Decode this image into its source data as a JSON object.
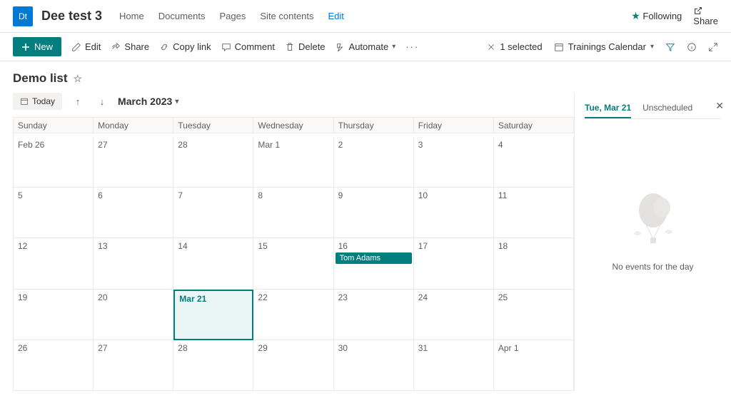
{
  "topbar": {
    "site_abbrev": "Dt",
    "site_title": "Dee test 3",
    "nav": {
      "home": "Home",
      "documents": "Documents",
      "pages": "Pages",
      "contents": "Site contents",
      "edit": "Edit"
    },
    "following": "Following",
    "share": "Share"
  },
  "cmdbar": {
    "new_label": "New",
    "edit": "Edit",
    "share": "Share",
    "copylink": "Copy link",
    "comment": "Comment",
    "delete": "Delete",
    "automate": "Automate",
    "selected": "1 selected",
    "view_name": "Trainings Calendar"
  },
  "page": {
    "title": "Demo list"
  },
  "calendar": {
    "today": "Today",
    "month_label": "March 2023",
    "day_headers": [
      "Sunday",
      "Monday",
      "Tuesday",
      "Wednesday",
      "Thursday",
      "Friday",
      "Saturday"
    ],
    "weeks": [
      [
        "Feb 26",
        "27",
        "28",
        "Mar 1",
        "2",
        "3",
        "4"
      ],
      [
        "5",
        "6",
        "7",
        "8",
        "9",
        "10",
        "11"
      ],
      [
        "12",
        "13",
        "14",
        "15",
        "16",
        "17",
        "18"
      ],
      [
        "19",
        "20",
        "Mar 21",
        "22",
        "23",
        "24",
        "25"
      ],
      [
        "26",
        "27",
        "28",
        "29",
        "30",
        "31",
        "Apr 1"
      ]
    ],
    "selected_index": "3.2",
    "events": {
      "2.4": "Tom Adams"
    }
  },
  "side": {
    "tab_date": "Tue, Mar 21",
    "tab_unscheduled": "Unscheduled",
    "empty_text": "No events for the day"
  }
}
